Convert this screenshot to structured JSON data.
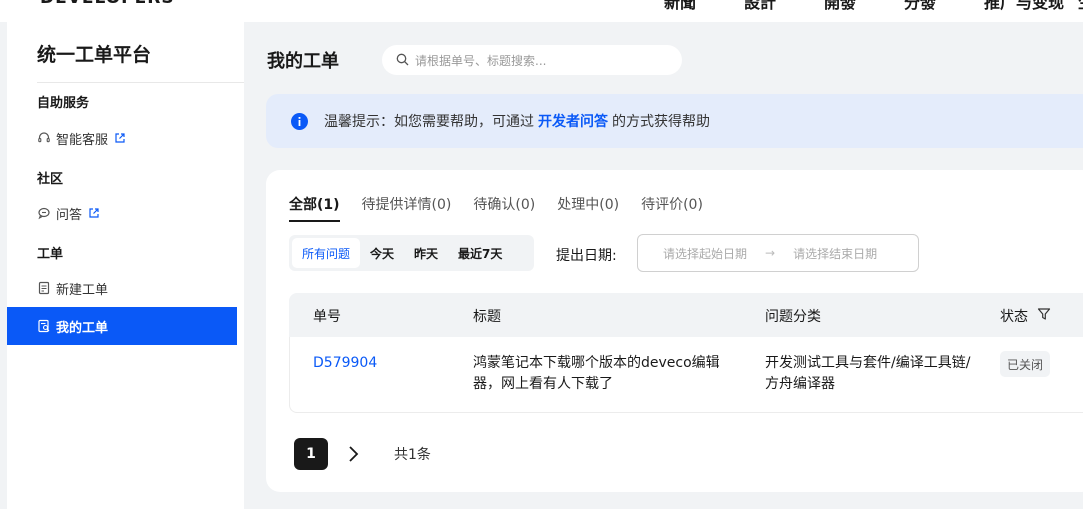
{
  "topbar": {
    "brand": "DEVELOPERS",
    "nav": [
      "新聞",
      "設計",
      "開發",
      "分發",
      "推广与变现",
      "生态"
    ]
  },
  "sidebar": {
    "title": "统一工单平台",
    "sections": [
      {
        "label": "自助服务"
      },
      {
        "label": "社区"
      },
      {
        "label": "工单"
      }
    ],
    "items": [
      {
        "label": "智能客服",
        "icon": "headset-icon",
        "external": true
      },
      {
        "label": "问答",
        "icon": "chat-icon",
        "external": true
      },
      {
        "label": "新建工单",
        "icon": "document-icon",
        "external": false
      },
      {
        "label": "我的工单",
        "icon": "document-search-icon",
        "active": true
      }
    ]
  },
  "main": {
    "title": "我的工单",
    "search_placeholder": "请根据单号、标题搜索...",
    "notice": {
      "prefix": "温馨提示：如您需要帮助，可通过",
      "link": "开发者问答",
      "suffix": "的方式获得帮助"
    },
    "tabs": [
      {
        "label": "全部(1)",
        "active": true
      },
      {
        "label": "待提供详情(0)"
      },
      {
        "label": "待确认(0)"
      },
      {
        "label": "处理中(0)"
      },
      {
        "label": "待评价(0)"
      }
    ],
    "filters": [
      {
        "label": "所有问题",
        "active": true
      },
      {
        "label": "今天"
      },
      {
        "label": "昨天"
      },
      {
        "label": "最近7天"
      }
    ],
    "date_label": "提出日期:",
    "date_start_placeholder": "请选择起始日期",
    "date_end_placeholder": "请选择结束日期",
    "date_arrow": "→",
    "table": {
      "headers": [
        "单号",
        "标题",
        "问题分类",
        "状态"
      ],
      "rows": [
        {
          "id": "D579904",
          "title": "鸿蒙笔记本下载哪个版本的deveco编辑器，网上看有人下载了",
          "category": "开发测试工具与套件/编译工具链/方舟编译器",
          "status": "已关闭"
        }
      ]
    },
    "pagination": {
      "current": "1",
      "total_text": "共1条"
    }
  },
  "colors": {
    "accent": "#0a59f7",
    "background": "#f1f3f5"
  }
}
